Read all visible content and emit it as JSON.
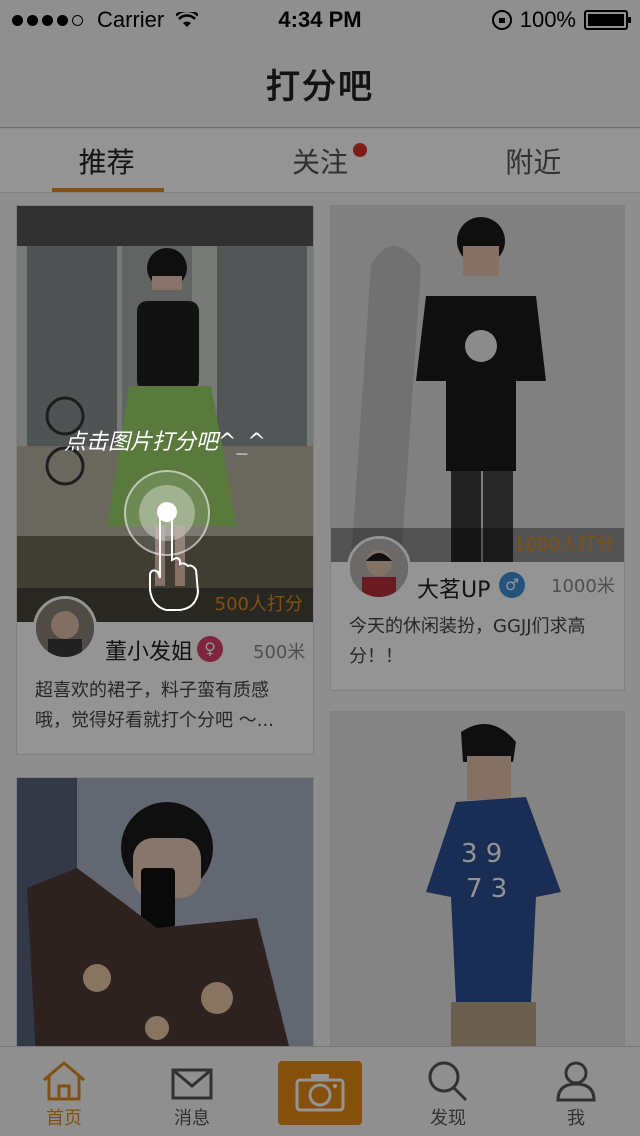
{
  "status_bar": {
    "carrier": "Carrier",
    "time": "4:34 PM",
    "battery": "100%"
  },
  "nav": {
    "title": "打分吧"
  },
  "tabs": [
    {
      "label": "推荐",
      "active": true
    },
    {
      "label": "关注",
      "has_badge": true
    },
    {
      "label": "附近"
    }
  ],
  "overlay_hint": "点击图片打分吧^_^",
  "posts": [
    {
      "score_text": "500人打分",
      "username": "董小发姐",
      "gender": "female",
      "distance": "500米",
      "description": "超喜欢的裙子，料子蛮有质感哦，觉得好看就打个分吧 ～..."
    },
    {
      "score_text": "1000人打分",
      "username": "大茗UP",
      "gender": "male",
      "distance": "1000米",
      "description": "今天的休闲装扮，GGJJ们求高分！！"
    },
    {},
    {}
  ],
  "tab_bar": [
    {
      "label": "首页",
      "icon": "home-icon",
      "active": true
    },
    {
      "label": "消息",
      "icon": "mail-icon"
    },
    {
      "label": "",
      "icon": "camera-icon"
    },
    {
      "label": "发现",
      "icon": "search-icon"
    },
    {
      "label": "我",
      "icon": "person-icon"
    }
  ],
  "colors": {
    "accent": "#e08a1e",
    "badge": "#d9322f"
  }
}
